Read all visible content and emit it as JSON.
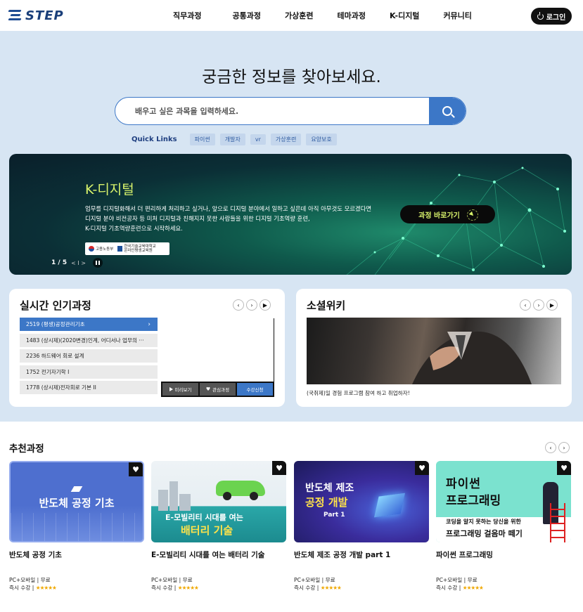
{
  "header": {
    "logo_text": "STEP",
    "nav": [
      "직무과정",
      "공통과정",
      "가상훈련",
      "테마과정",
      "K-디지털",
      "커뮤니티"
    ],
    "login_label": "로그인"
  },
  "hero": {
    "title": "궁금한 정보를 찾아보세요.",
    "search_placeholder": "배우고 싶은 과목을 입력하세요.",
    "quick_links_label": "Quick Links",
    "quick_links": [
      "파이썬",
      "개발자",
      "vr",
      "가상훈련",
      "요양보호"
    ]
  },
  "banner": {
    "title": "K-디지털",
    "desc_lines": [
      "업무를 디지털화해서 더 편리하게 처리하고 싶거나, 앞으로 디지털 분야에서 일하고 싶은데 아직 아무것도 모르겠다면",
      "디지털 분야 비전공자 등 미처 디지털과 친해지지 못한 사람들을 위한 디지털 기초역량 훈련,",
      "K-디지털 기초역량훈련으로 시작하세요."
    ],
    "logo1": "고용노동부",
    "logo2a": "한국기술교육대학교",
    "logo2b": "온라인평생교육원",
    "go_label": "과정 바로가기",
    "pager": "1 / 5",
    "pager_nav": "< I >"
  },
  "popular": {
    "title": "실시간 인기과정",
    "items": [
      "2519 (평생)공정관리기초",
      "1483 (상시제)(2020변경)인계, 어디서나 업무의 ···",
      "2236 하드웨어 회로 설계",
      "1752 전기자기학 I",
      "1778 (상시제)전자회로 기본 II"
    ],
    "buttons": {
      "preview": "미리보기",
      "wish": "관심과정",
      "apply": "수강신청"
    }
  },
  "wiki": {
    "title": "소셜위키",
    "caption": "(국취제)일 경험 프로그램 참여 하고 취업하자!"
  },
  "recommended": {
    "title": "추천과정",
    "cards": [
      {
        "title": "반도체 공정 기초",
        "img_text": "반도체 공정 기초",
        "meta1": "PC+모바일 | 무료",
        "meta2": "즉시 수강 |",
        "stars": "★★★★★"
      },
      {
        "title": "E-모빌리티 시대를 여는 배터리 기술",
        "img_text1": "E-모빌리티 시대를 여는",
        "img_text2": "배터리 기술",
        "meta1": "PC+모바일 | 무료",
        "meta2": "즉시 수강 |",
        "stars": "★★★★★"
      },
      {
        "title": "반도체 제조 공정 개발 part 1",
        "img_text1": "반도체 제조",
        "img_text2": "공정 개발",
        "img_text3": "Part 1",
        "meta1": "PC+모바일 | 무료",
        "meta2": "즉시 수강 |",
        "stars": "★★★★★"
      },
      {
        "title": "파이썬 프로그래밍",
        "img_text1": "파이썬",
        "img_text2": "프로그래밍",
        "img_text3": "코딩을 알지 못하는 당신을 위한",
        "img_text4": "프로그래밍 걸음마 떼기",
        "meta1": "PC+모바일 | 무료",
        "meta2": "즉시 수강 |",
        "stars": "★★★★★"
      }
    ]
  },
  "colors": {
    "accent": "#3c77c7",
    "bg": "#d7e5f3",
    "banner_text": "#d7f26b"
  }
}
